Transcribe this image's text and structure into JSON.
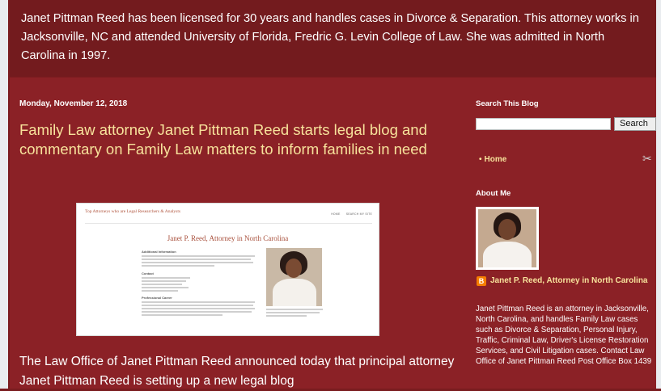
{
  "header": {
    "text": "Janet Pittman Reed has been licensed for 30 years and handles cases in Divorce & Separation. This attorney works in Jacksonville, NC and attended University of Florida, Fredric G. Levin College of Law. She was admitted in North Carolina in 1997."
  },
  "post": {
    "date": "Monday, November 12, 2018",
    "title": "Family Law attorney Janet Pittman Reed starts legal blog and commentary on Family Law matters to inform families in need",
    "body": "The Law Office of Janet Pittman Reed announced today that principal attorney Janet Pittman Reed is setting up a new legal blog",
    "embed": {
      "site_name": "Top Attorneys who are Legal Researchers & Analysts",
      "nav": [
        "HOME",
        "SEARCH MY SITE"
      ],
      "page_title": "Janet P. Reed, Attorney in North Carolina",
      "sections": [
        "Additional Information",
        "Contact",
        "Professional Career"
      ]
    }
  },
  "sidebar": {
    "search_heading": "Search This Blog",
    "search_button": "Search",
    "search_value": "",
    "nav_home": "Home",
    "about_heading": "About Me",
    "profile_name": "Janet P. Reed, Attorney in North Carolina",
    "profile_bio": "Janet Pittman Reed is an attorney in Jacksonville, North Carolina, and handles Family Law cases such as Divorce & Separation, Personal Injury, Traffic, Criminal Law, Driver's License Restoration Services, and Civil Litigation cases. Contact Law Office of Janet Pittman Reed Post Office Box 1439"
  },
  "colors": {
    "header_bg": "#731b1e",
    "content_bg": "#8b2126",
    "title_color": "#f7e29b",
    "link_color": "#f7e29b",
    "blogger_orange": "#f57d00"
  },
  "icons": [
    "blogger-icon",
    "wrench-icon",
    "bullet-icon"
  ]
}
